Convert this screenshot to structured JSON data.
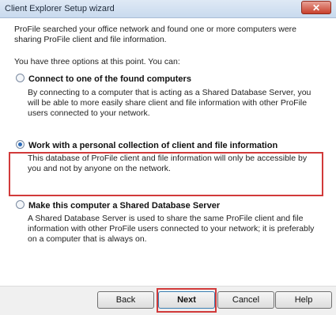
{
  "window": {
    "title": "Client Explorer Setup wizard",
    "close_glyph": "✕"
  },
  "intro": "ProFile searched your office network and found one or more computers were sharing ProFile client and file information.",
  "options_prompt": "You have three options at this point. You can:",
  "options": [
    {
      "label": "Connect to one of the found computers",
      "description": "By connecting to a computer that is acting as a Shared Database Server, you will be able to more easily share client and file information with other ProFile users connected to your network.",
      "selected": false
    },
    {
      "label": "Work with a personal collection of client and file information",
      "description": "This database of ProFile client and file information will only be accessible by you and not by anyone on the network.",
      "selected": true
    },
    {
      "label": "Make this computer a Shared Database Server",
      "description": "A Shared Database Server is used to share the same ProFile client and file information with other ProFile users connected to your network; it is preferably on a computer that is always on.",
      "selected": false
    }
  ],
  "buttons": {
    "back": "Back",
    "next": "Next",
    "cancel": "Cancel",
    "help": "Help"
  },
  "colors": {
    "highlight": "#d13a3a",
    "radio_selected": "#2b6ab8"
  }
}
